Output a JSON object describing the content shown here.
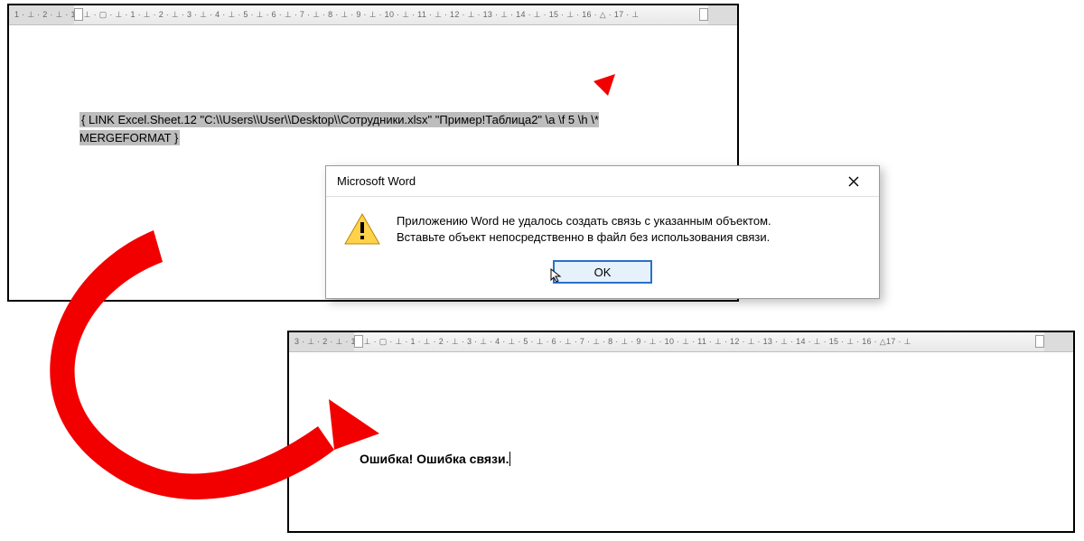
{
  "panel1": {
    "ruler_text": "1 · ⊥ · 2 · ⊥ · 1 · ⊥ · ▢ · ⊥ · 1 · ⊥ · 2 · ⊥ · 3 · ⊥ · 4 · ⊥ · 5 · ⊥ · 6 · ⊥ · 7 · ⊥ · 8 · ⊥ · 9 · ⊥ · 10 · ⊥ · 11 · ⊥ · 12 · ⊥ · 13 · ⊥ · 14 · ⊥ · 15 · ⊥ · 16 · △ · 17 · ⊥",
    "field_code_line1": "{ LINK Excel.Sheet.12 \"C:\\\\Users\\\\User\\\\Desktop\\\\Сотрудники.xlsx\" \"Пример!Таблица2\" \\a \\f 5 \\h  \\*",
    "field_code_line2": "MERGEFORMAT }"
  },
  "dialog": {
    "title": "Microsoft Word",
    "message_line1": "Приложению Word не удалось создать связь с указанным объектом.",
    "message_line2": "Вставьте объект непосредственно в файл без использования связи.",
    "ok_label": "OK"
  },
  "panel2": {
    "ruler_text": "3 · ⊥ · 2 · ⊥ · 1 · ⊥ · ▢ · ⊥ · 1 · ⊥ · 2 · ⊥ · 3 · ⊥ · 4 · ⊥ · 5 · ⊥ · 6 · ⊥ · 7 · ⊥ · 8 · ⊥ · 9 · ⊥ · 10 · ⊥ · 11 · ⊥ · 12 · ⊥ · 13 · ⊥ · 14 · ⊥ · 15 · ⊥ · 16 · △17 · ⊥",
    "error_text": "Ошибка! Ошибка связи."
  },
  "annotation_arrows": {
    "small": "arrow-to-table2-ref",
    "big": "arrow-panel1-to-panel2"
  }
}
